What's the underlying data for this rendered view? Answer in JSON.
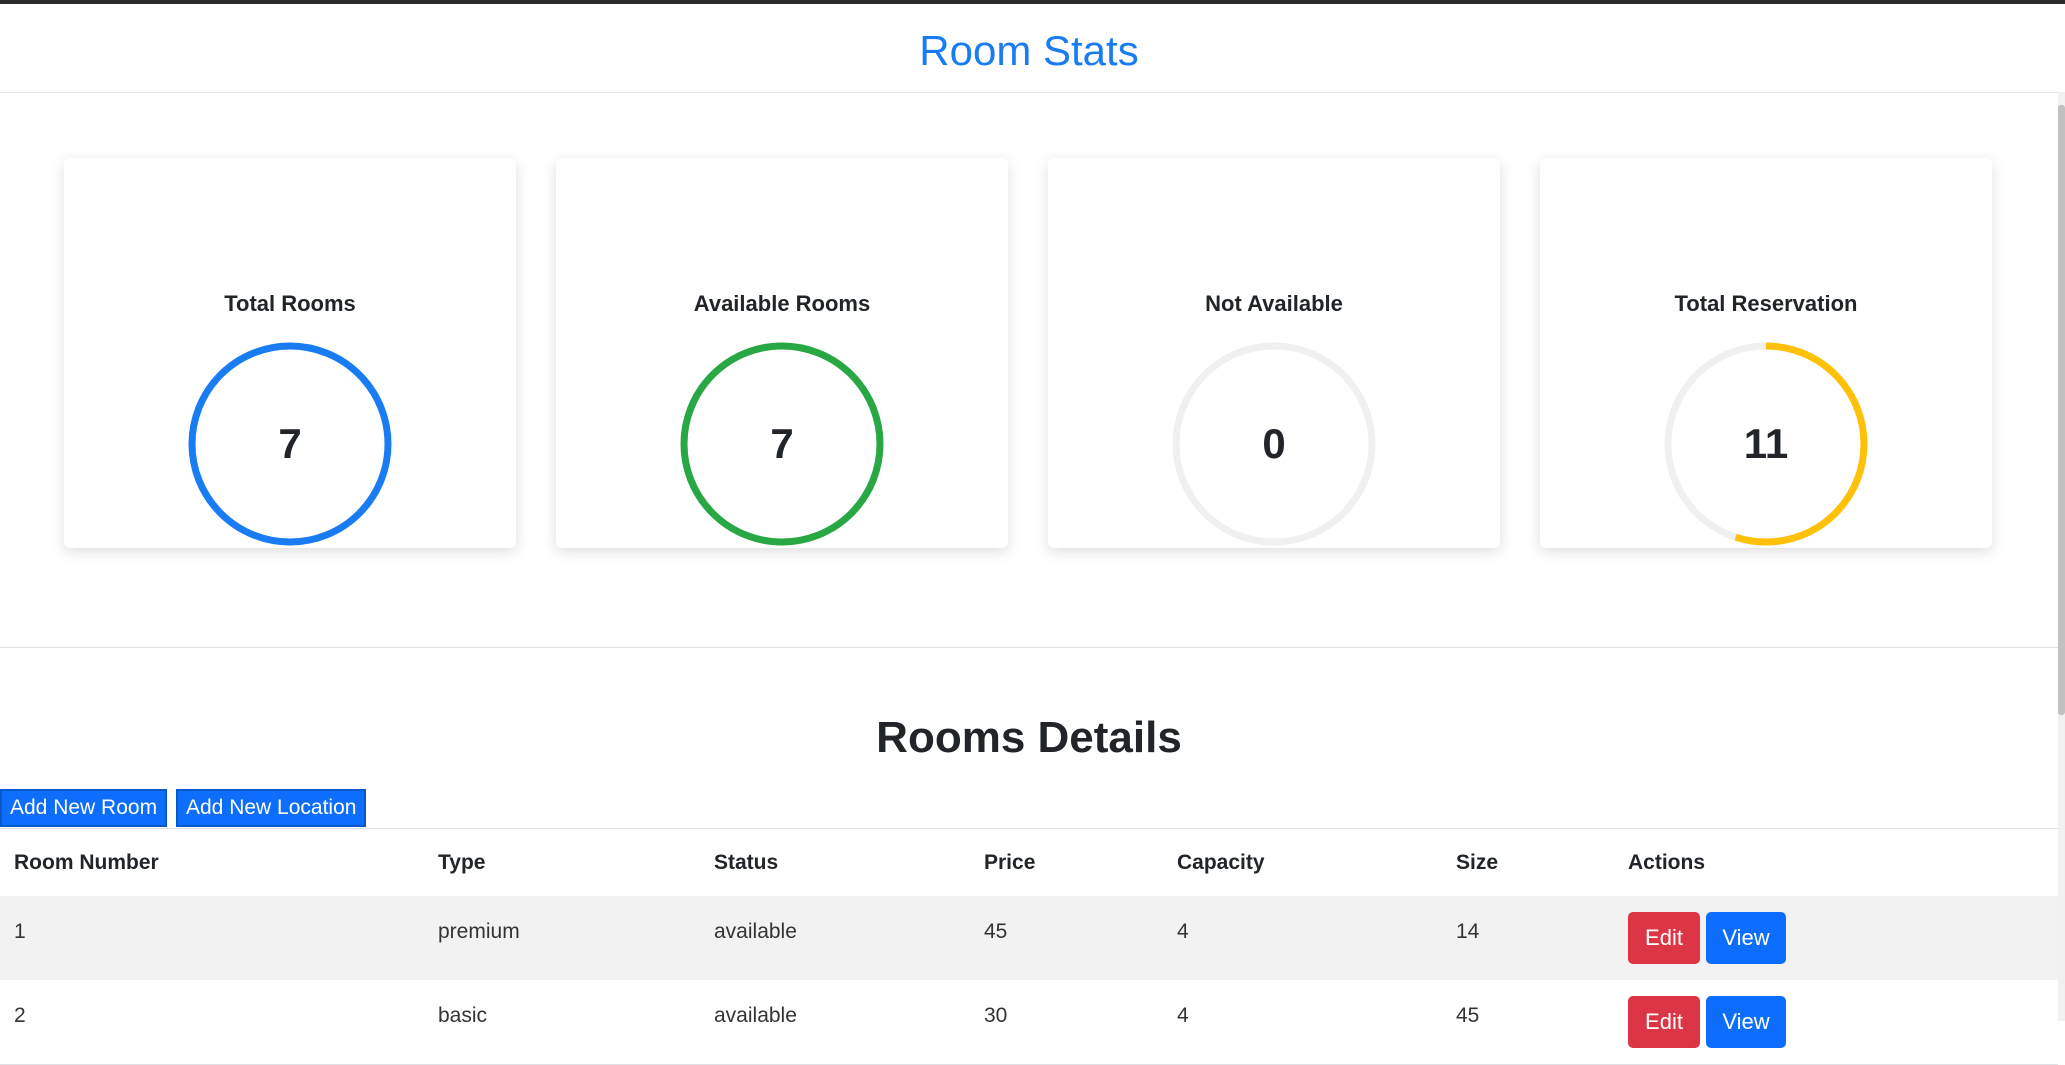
{
  "header": {
    "title": "Room Stats"
  },
  "stats": [
    {
      "label": "Total Rooms",
      "value": "7",
      "color": "#1a7cf2",
      "fill_fraction": 1.0
    },
    {
      "label": "Available Rooms",
      "value": "7",
      "color": "#28a745",
      "fill_fraction": 1.0
    },
    {
      "label": "Not Available",
      "value": "0",
      "color": "#f0f0f0",
      "fill_fraction": 0.0
    },
    {
      "label": "Total Reservation",
      "value": "11",
      "color": "#ffc107",
      "fill_fraction": 0.55
    }
  ],
  "details": {
    "title": "Rooms Details",
    "add_room_label": "Add New Room",
    "add_location_label": "Add New Location"
  },
  "table": {
    "headers": [
      "Room Number",
      "Type",
      "Status",
      "Price",
      "Capacity",
      "Size",
      "Actions"
    ],
    "rows": [
      {
        "room_number": "1",
        "type": "premium",
        "status": "available",
        "price": "45",
        "capacity": "4",
        "size": "14"
      },
      {
        "room_number": "2",
        "type": "basic",
        "status": "available",
        "price": "30",
        "capacity": "4",
        "size": "45"
      }
    ],
    "edit_label": "Edit",
    "view_label": "View"
  },
  "colors": {
    "accent": "#1a7cf2",
    "danger": "#dc3545",
    "primary": "#0d6efd",
    "track": "#f0f0f0"
  }
}
